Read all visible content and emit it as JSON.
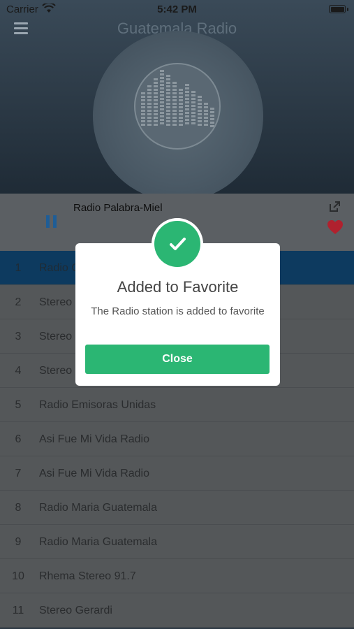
{
  "status_bar": {
    "carrier": "Carrier",
    "time": "5:42 PM"
  },
  "header": {
    "title": "Guatemala Radio"
  },
  "player": {
    "station": "Radio Palabra-Miel"
  },
  "stations": [
    {
      "num": "1",
      "name": "Radio C"
    },
    {
      "num": "2",
      "name": "Stereo"
    },
    {
      "num": "3",
      "name": "Stereo"
    },
    {
      "num": "4",
      "name": "Stereo"
    },
    {
      "num": "5",
      "name": "Radio Emisoras Unidas"
    },
    {
      "num": "6",
      "name": "Asi Fue Mi Vida Radio"
    },
    {
      "num": "7",
      "name": "Asi Fue Mi Vida Radio"
    },
    {
      "num": "8",
      "name": "Radio Maria Guatemala"
    },
    {
      "num": "9",
      "name": "Radio Maria Guatemala"
    },
    {
      "num": "10",
      "name": "Rhema Stereo 91.7"
    },
    {
      "num": "11",
      "name": "Stereo Gerardi"
    }
  ],
  "modal": {
    "title": "Added to Favorite",
    "message": "The Radio station is added to favorite",
    "close_label": "Close"
  },
  "colors": {
    "accent": "#2bb673",
    "active_row": "#0d3a5f",
    "heart": "#b0212e",
    "pause": "#1f5d96"
  },
  "icons": {
    "menu": "hamburger-menu-icon",
    "pause": "pause-icon",
    "share": "share-icon",
    "favorite": "heart-icon",
    "success": "checkmark-icon"
  }
}
